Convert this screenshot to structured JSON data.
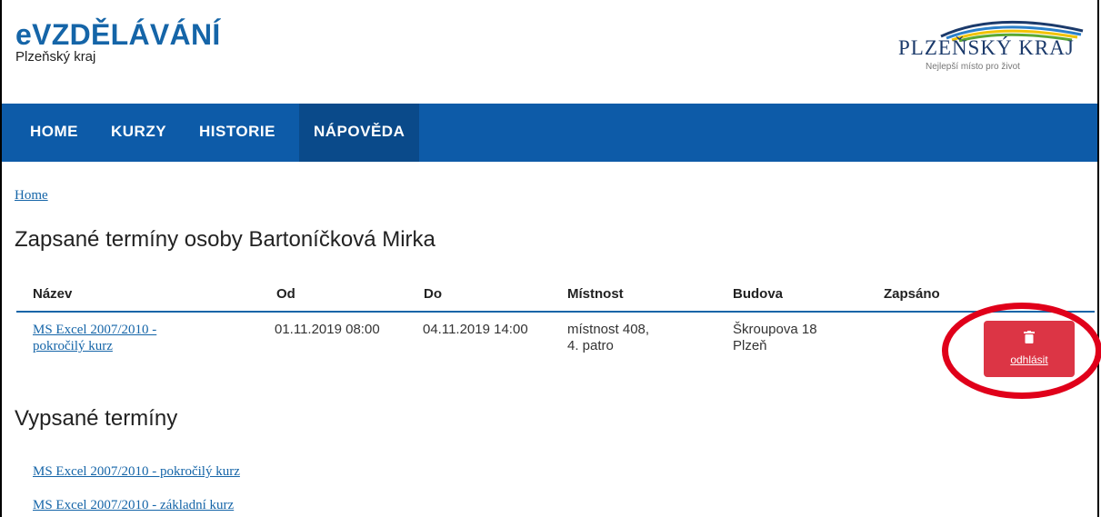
{
  "brand": {
    "title": "eVZDĚLÁVÁNÍ",
    "subtitle": "Plzeňský kraj"
  },
  "logo": {
    "name": "PLZEŇSKÝ KRAJ",
    "tagline": "Nejlepší místo pro život",
    "colors": [
      "#1b3a6b",
      "#2b7fc9",
      "#f2c300",
      "#5aa832"
    ]
  },
  "nav": {
    "items": [
      "HOME",
      "KURZY",
      "HISTORIE",
      "NÁPOVĚDA"
    ],
    "active": "NÁPOVĚDA"
  },
  "breadcrumb": "Home",
  "page_title": "Zapsané termíny osoby Bartoníčková Mirka",
  "table": {
    "headers": [
      "Název",
      "Od",
      "Do",
      "Místnost",
      "Budova",
      "Zapsáno"
    ],
    "rows": [
      {
        "name_line1": "MS Excel 2007/2010 -",
        "name_line2": "pokročilý kurz",
        "from": "01.11.2019 08:00",
        "to": "04.11.2019 14:00",
        "room_line1": "místnost 408,",
        "room_line2": "4. patro",
        "building_line1": "Škroupova 18",
        "building_line2": "Plzeň",
        "action_label": "odhlásit",
        "action_icon": "trash-icon"
      }
    ]
  },
  "section_title": "Vypsané termíny",
  "terms": [
    "MS Excel 2007/2010 - pokročilý kurz",
    "MS Excel 2007/2010 - základní kurz"
  ],
  "colors": {
    "brand": "#1565a8",
    "nav": "#0d5ba8",
    "danger": "#dc3545",
    "highlight": "#e0001a"
  }
}
